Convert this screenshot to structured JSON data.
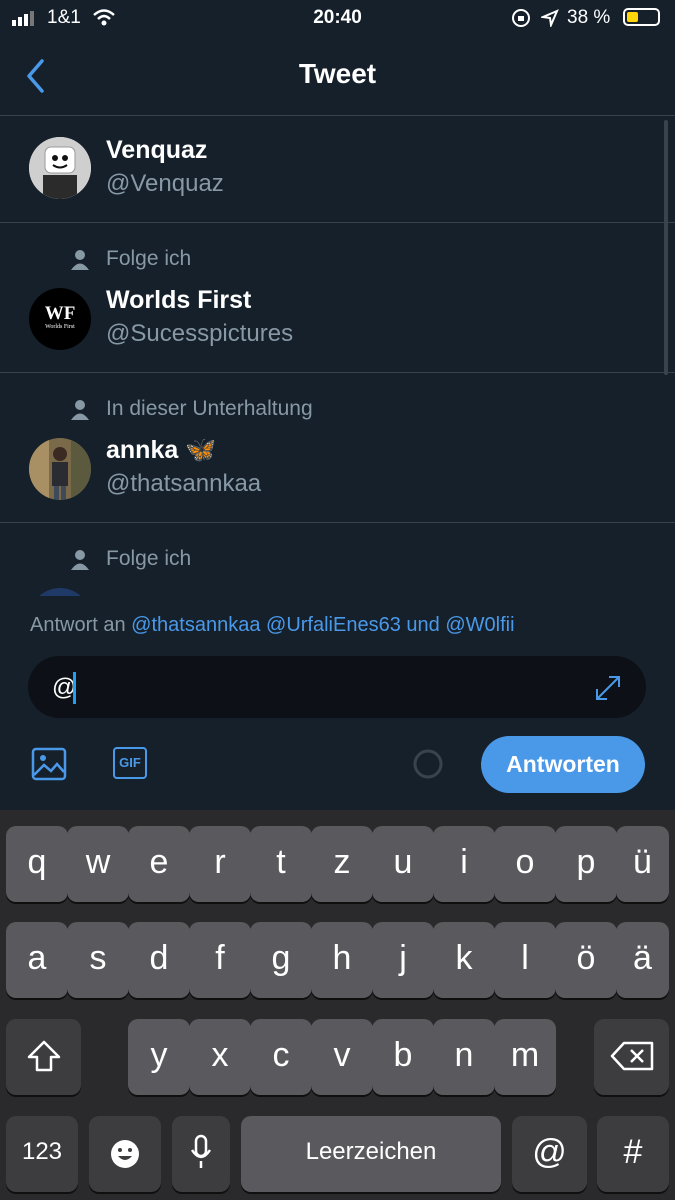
{
  "status_bar": {
    "carrier": "1&1",
    "time": "20:40",
    "battery": "38 %"
  },
  "header": {
    "title": "Tweet",
    "back_icon": "chevron-left-icon"
  },
  "users": [
    {
      "context": "",
      "name": "Venquaz",
      "handle": "@Venquaz"
    },
    {
      "context": "Folge ich",
      "name": "Worlds First",
      "handle": "@Sucesspictures",
      "avatar_text": "WF",
      "avatar_subtext": "Worlds First"
    },
    {
      "context": "In dieser Unterhaltung",
      "name": "annka 🦋",
      "handle": "@thatsannkaa"
    },
    {
      "context": "Folge ich",
      "name": "",
      "handle": ""
    }
  ],
  "reply": {
    "prefix": "Antwort an",
    "mentions": [
      "@thatsannkaa",
      "@UrfaliEnes63"
    ],
    "conjunction": "und",
    "last_mention": "@W0lfii",
    "input_value": "@",
    "button_label": "Antworten",
    "gif_label": "GIF"
  },
  "keyboard": {
    "row1": [
      "q",
      "w",
      "e",
      "r",
      "t",
      "z",
      "u",
      "i",
      "o",
      "p",
      "ü"
    ],
    "row2": [
      "a",
      "s",
      "d",
      "f",
      "g",
      "h",
      "j",
      "k",
      "l",
      "ö",
      "ä"
    ],
    "row3": [
      "y",
      "x",
      "c",
      "v",
      "b",
      "n",
      "m"
    ],
    "numbers": "123",
    "space": "Leerzeichen",
    "at": "@",
    "hash": "#"
  },
  "colors": {
    "background": "#15202b",
    "accent": "#4a99e9",
    "secondary_text": "#8899a6"
  }
}
